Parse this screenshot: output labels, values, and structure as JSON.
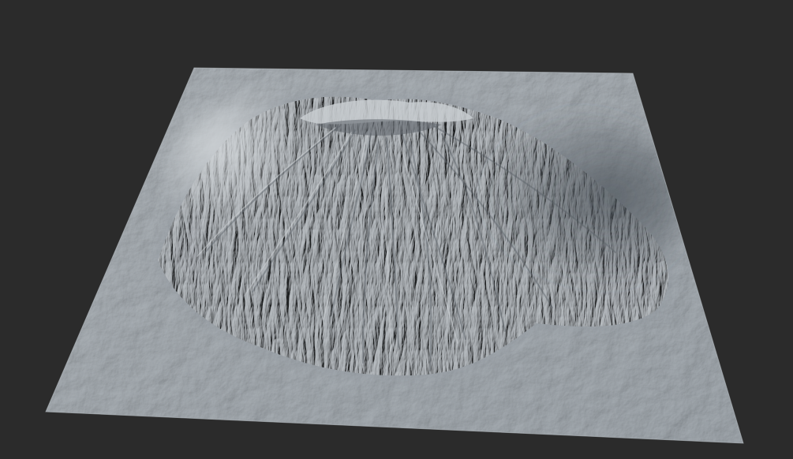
{
  "scene": {
    "background_color": "#2b2b2b",
    "terrain_base_color": "#8e969e",
    "terrain_highlight_color": "#c3c8cc",
    "terrain_shadow_color": "#4b5259"
  }
}
